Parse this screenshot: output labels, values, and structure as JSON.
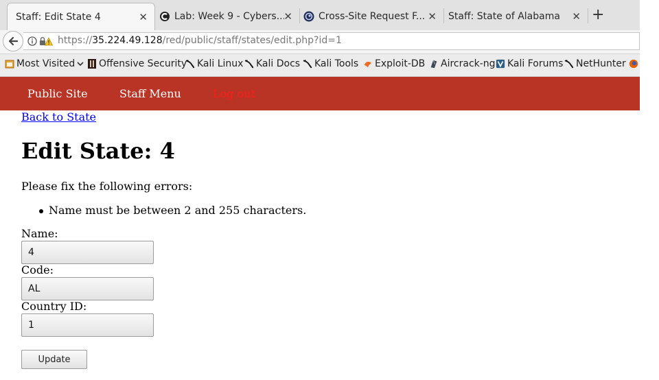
{
  "browser": {
    "tabs": [
      {
        "title": "Staff: Edit State 4",
        "active": true,
        "favicon": "none"
      },
      {
        "title": "Lab: Week 9 - Cybers...",
        "active": false,
        "favicon": "codepath-c-icon"
      },
      {
        "title": "Cross-Site Request F...",
        "active": false,
        "favicon": "owasp-icon"
      },
      {
        "title": "Staff: State of Alabama",
        "active": false,
        "favicon": "none"
      }
    ],
    "close_glyph": "✕",
    "new_tab_glyph": "+",
    "url": {
      "scheme": "https://",
      "host": "35.224.49.128",
      "path": "/red/public/staff/states/edit.php?id=1"
    },
    "bookmarks": [
      {
        "label": "Most Visited",
        "icon": "most-visited-icon"
      },
      {
        "label": "Offensive Security",
        "icon": "offsec-icon"
      },
      {
        "label": "Kali Linux",
        "icon": "kali-dragon-icon"
      },
      {
        "label": "Kali Docs",
        "icon": "kali-dragon-icon"
      },
      {
        "label": "Kali Tools",
        "icon": "kali-dragon-icon"
      },
      {
        "label": "Exploit-DB",
        "icon": "exploit-db-icon"
      },
      {
        "label": "Aircrack-ng",
        "icon": "aircrack-icon"
      },
      {
        "label": "Kali Forums",
        "icon": "kali-forums-icon"
      },
      {
        "label": "NetHunter",
        "icon": "kali-dragon-icon"
      }
    ]
  },
  "site": {
    "nav": {
      "public": "Public Site",
      "staff": "Staff Menu",
      "logout": "Log out"
    },
    "colors": {
      "header_bg": "#b93425",
      "logout": "#ff1a1a",
      "link": "#0000ee"
    }
  },
  "page": {
    "back_link": "Back to State",
    "title": "Edit State: 4",
    "errors_heading": "Please fix the following errors:",
    "errors": [
      "Name must be between 2 and 255 characters."
    ],
    "form": {
      "name_label": "Name:",
      "name_value": "4",
      "code_label": "Code:",
      "code_value": "AL",
      "country_label": "Country ID:",
      "country_value": "1",
      "submit_label": "Update"
    }
  }
}
